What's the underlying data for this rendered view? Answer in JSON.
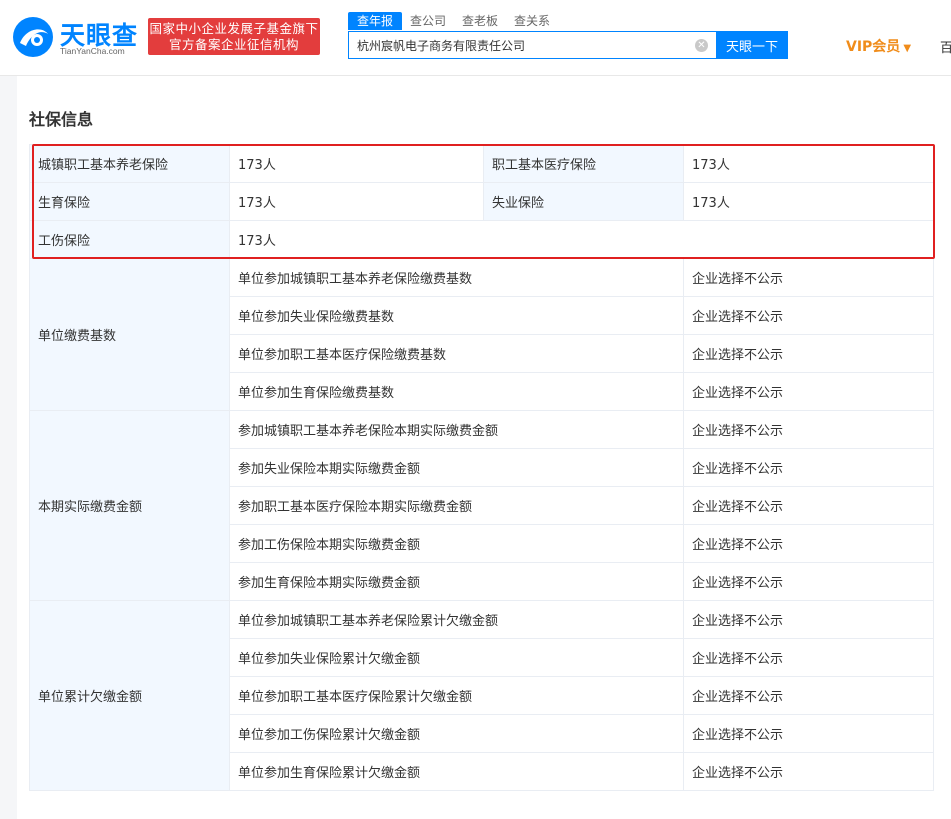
{
  "header": {
    "logo_text": "天眼查",
    "logo_sub": "TianYanCha.com",
    "badge_line1": "国家中小企业发展子基金旗下",
    "badge_line2": "官方备案企业征信机构",
    "tabs": [
      "查年报",
      "查公司",
      "查老板",
      "查关系"
    ],
    "search_value": "杭州宸帆电子商务有限责任公司",
    "search_button": "天眼一下",
    "vip_label": "VIP会员",
    "cut_text": "百"
  },
  "section": {
    "title": "社保信息"
  },
  "insurance": [
    {
      "label": "城镇职工基本养老保险",
      "value": "173人"
    },
    {
      "label": "职工基本医疗保险",
      "value": "173人"
    },
    {
      "label": "生育保险",
      "value": "173人"
    },
    {
      "label": "失业保险",
      "value": "173人"
    },
    {
      "label": "工伤保险",
      "value": "173人"
    }
  ],
  "groups": [
    {
      "label": "单位缴费基数",
      "rows": [
        {
          "item": "单位参加城镇职工基本养老保险缴费基数",
          "value": "企业选择不公示"
        },
        {
          "item": "单位参加失业保险缴费基数",
          "value": "企业选择不公示"
        },
        {
          "item": "单位参加职工基本医疗保险缴费基数",
          "value": "企业选择不公示"
        },
        {
          "item": "单位参加生育保险缴费基数",
          "value": "企业选择不公示"
        }
      ]
    },
    {
      "label": "本期实际缴费金额",
      "rows": [
        {
          "item": "参加城镇职工基本养老保险本期实际缴费金额",
          "value": "企业选择不公示"
        },
        {
          "item": "参加失业保险本期实际缴费金额",
          "value": "企业选择不公示"
        },
        {
          "item": "参加职工基本医疗保险本期实际缴费金额",
          "value": "企业选择不公示"
        },
        {
          "item": "参加工伤保险本期实际缴费金额",
          "value": "企业选择不公示"
        },
        {
          "item": "参加生育保险本期实际缴费金额",
          "value": "企业选择不公示"
        }
      ]
    },
    {
      "label": "单位累计欠缴金额",
      "rows": [
        {
          "item": "单位参加城镇职工基本养老保险累计欠缴金额",
          "value": "企业选择不公示"
        },
        {
          "item": "单位参加失业保险累计欠缴金额",
          "value": "企业选择不公示"
        },
        {
          "item": "单位参加职工基本医疗保险累计欠缴金额",
          "value": "企业选择不公示"
        },
        {
          "item": "单位参加工伤保险累计欠缴金额",
          "value": "企业选择不公示"
        },
        {
          "item": "单位参加生育保险累计欠缴金额",
          "value": "企业选择不公示"
        }
      ]
    }
  ],
  "colors": {
    "brand": "#0084ff",
    "badge": "#e33d3d",
    "vip": "#f08c1a",
    "highlight": "#e02020",
    "label_bg": "#f2f8ff"
  }
}
